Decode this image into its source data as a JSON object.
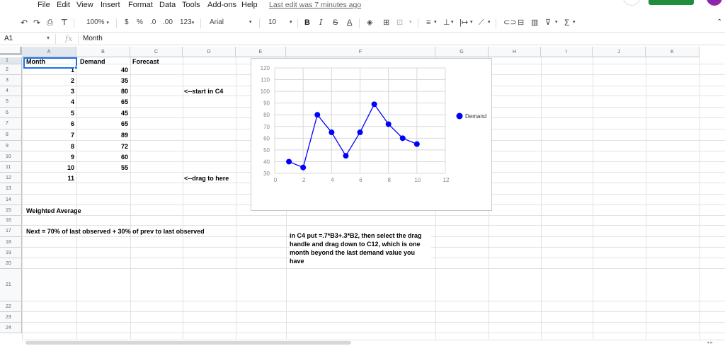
{
  "menu": {
    "items": [
      "File",
      "Edit",
      "View",
      "Insert",
      "Format",
      "Data",
      "Tools",
      "Add-ons",
      "Help"
    ],
    "last_edit": "Last edit was 7 minutes ago"
  },
  "toolbar": {
    "zoom": "100%",
    "currency": "$",
    "percent": "%",
    "decrease_decimal": ".0",
    "increase_decimal": ".00",
    "more_formats": "123",
    "font": "Arial",
    "font_size": "10",
    "bold": "B",
    "italic": "I",
    "strikethrough": "S",
    "text_color": "A",
    "functions": "Σ"
  },
  "formula_bar": {
    "name_box": "A1",
    "fx": "fx",
    "value": "Month"
  },
  "columns": [
    "A",
    "B",
    "C",
    "D",
    "E",
    "F",
    "G",
    "H",
    "I",
    "J",
    "K"
  ],
  "rows": [
    "1",
    "2",
    "3",
    "4",
    "5",
    "6",
    "7",
    "8",
    "9",
    "10",
    "11",
    "12",
    "13",
    "14",
    "15",
    "16",
    "17",
    "18",
    "19",
    "20",
    "21",
    "22",
    "23",
    "24"
  ],
  "cells": {
    "a1": "Month",
    "b1": "Demand",
    "c1": "Forecast",
    "months": [
      "1",
      "2",
      "3",
      "4",
      "5",
      "6",
      "7",
      "8",
      "9",
      "10",
      "11"
    ],
    "demand": [
      "40",
      "35",
      "80",
      "65",
      "45",
      "65",
      "89",
      "72",
      "60",
      "55"
    ],
    "d4": "<--start in C4",
    "d12": "<--drag to here",
    "a15": "Weighted Average",
    "a17": "Next = 70% of last observed + 30% of prev to last observed",
    "f21": "in C4 put =.7*B3+.3*B2, then select the drag handle and drag down to C12, which is one month beyond the last demand value you have"
  },
  "chart_data": {
    "type": "line",
    "x": [
      1,
      2,
      3,
      4,
      5,
      6,
      7,
      8,
      9,
      10
    ],
    "series": [
      {
        "name": "Demand",
        "values": [
          40,
          35,
          80,
          65,
          45,
          65,
          89,
          72,
          60,
          55
        ],
        "color": "#0000ff"
      }
    ],
    "xlim": [
      0,
      12
    ],
    "ylim": [
      30,
      120
    ],
    "x_ticks": [
      0,
      2,
      4,
      6,
      8,
      10,
      12
    ],
    "y_ticks": [
      30,
      40,
      50,
      60,
      70,
      80,
      90,
      100,
      110,
      120
    ],
    "grid": true,
    "legend": "top-right",
    "title": "",
    "xlabel": "",
    "ylabel": ""
  },
  "colors": {
    "accent": "#1a73e8",
    "series": "#0000ff",
    "share": "#1e8e3e"
  }
}
